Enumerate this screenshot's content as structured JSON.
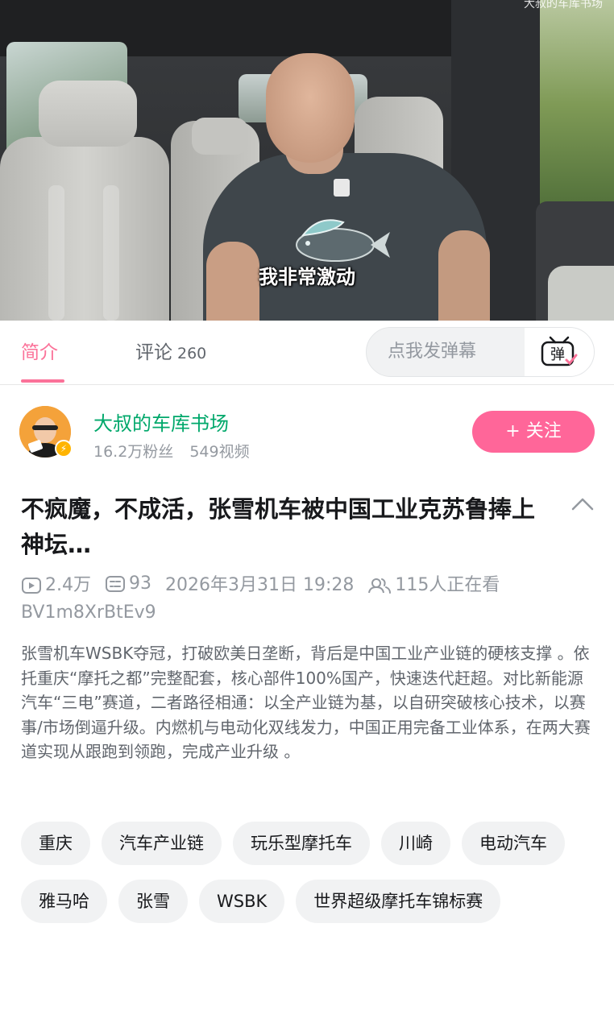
{
  "video": {
    "subtitle": "我非常激动",
    "top_overlay": "大叔的车库书场"
  },
  "tabs": {
    "intro": "简介",
    "comments": "评论",
    "comments_count": "260",
    "danmaku_placeholder": "点我发弹幕",
    "danmaku_button": "弹"
  },
  "uploader": {
    "name": "大叔的车库书场",
    "fans": "16.2万粉丝",
    "videos": "549视频",
    "follow_label": "+ 关注"
  },
  "video_info": {
    "title": "不疯魔，不成活，张雪机车被中国工业克苏鲁捧上神坛…",
    "views": "2.4万",
    "danmaku_count": "93",
    "publish_time": "2026年3月31日 19:28",
    "watching": "115人正在看",
    "bvid": "BV1m8XrBtEv9",
    "description": "张雪机车WSBK夺冠，打破欧美日垄断，背后是中国工业产业链的硬核支撑 。依托重庆“摩托之都”完整配套，核心部件100%国产，快速迭代赶超。对比新能源汽车“三电”赛道，二者路径相通：以全产业链为基，以自研突破核心技术，以赛事/市场倒逼升级。内燃机与电动化双线发力，中国正用完备工业体系，在两大赛道实现从跟跑到领跑，完成产业升级 。"
  },
  "tags": [
    "重庆",
    "汽车产业链",
    "玩乐型摩托车",
    "川崎",
    "电动汽车",
    "雅马哈",
    "张雪",
    "WSBK",
    "世界超级摩托车锦标赛"
  ],
  "colors": {
    "accent": "#fb7299",
    "follow": "#ff6699",
    "uploader_name": "#00a86b"
  }
}
